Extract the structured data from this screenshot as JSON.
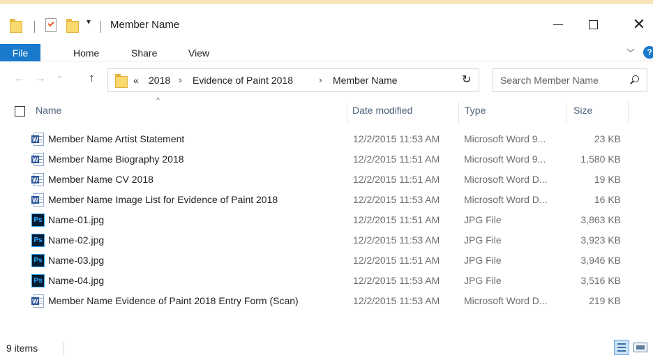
{
  "window": {
    "title": "Member Name",
    "qa_dropdown_glyph": "▾",
    "controls": {
      "minimize_icon": "minimize-icon",
      "maximize_icon": "maximize-icon",
      "close_icon": "close-icon"
    }
  },
  "ribbon": {
    "tabs": [
      {
        "label": "File"
      },
      {
        "label": "Home"
      },
      {
        "label": "Share"
      },
      {
        "label": "View"
      }
    ],
    "expand_glyph": "﹀",
    "help_glyph": "?",
    "accent_color": "#1979ca"
  },
  "nav": {
    "back_glyph": "←",
    "forward_glyph": "→",
    "recent_glyph": "⌄",
    "up_glyph": "↑",
    "refresh_glyph": "↻"
  },
  "address": {
    "overflow": "«",
    "crumbs": [
      "2018",
      "Evidence of Paint 2018",
      "Member Name"
    ],
    "separator": "›",
    "dropdown_glyph": "⌄"
  },
  "search": {
    "placeholder": "Search Member Name"
  },
  "columns": {
    "sort_glyph": "^",
    "name": "Name",
    "date": "Date modified",
    "type": "Type",
    "size": "Size"
  },
  "files": [
    {
      "icon": "word-doc-icon",
      "badge": "W",
      "name": "Member Name Artist Statement",
      "date": "12/2/2015 11:53 AM",
      "type": "Microsoft Word 9...",
      "size": "23 KB"
    },
    {
      "icon": "word-doc-icon",
      "badge": "W",
      "name": "Member Name Biography 2018",
      "date": "12/2/2015 11:51 AM",
      "type": "Microsoft Word 9...",
      "size": "1,580 KB"
    },
    {
      "icon": "word-docx-icon",
      "badge": "W",
      "name": "Member Name CV 2018",
      "date": "12/2/2015 11:51 AM",
      "type": "Microsoft Word D...",
      "size": "19 KB"
    },
    {
      "icon": "word-docx-icon",
      "badge": "W",
      "name": "Member Name Image List for Evidence of Paint 2018",
      "date": "12/2/2015 11:53 AM",
      "type": "Microsoft Word D...",
      "size": "16 KB"
    },
    {
      "icon": "photoshop-icon",
      "badge": "Ps",
      "name": "Name-01.jpg",
      "date": "12/2/2015 11:51 AM",
      "type": "JPG File",
      "size": "3,863 KB"
    },
    {
      "icon": "photoshop-icon",
      "badge": "Ps",
      "name": "Name-02.jpg",
      "date": "12/2/2015 11:53 AM",
      "type": "JPG File",
      "size": "3,923 KB"
    },
    {
      "icon": "photoshop-icon",
      "badge": "Ps",
      "name": "Name-03.jpg",
      "date": "12/2/2015 11:51 AM",
      "type": "JPG File",
      "size": "3,946 KB"
    },
    {
      "icon": "photoshop-icon",
      "badge": "Ps",
      "name": "Name-04.jpg",
      "date": "12/2/2015 11:53 AM",
      "type": "JPG File",
      "size": "3,516 KB"
    },
    {
      "icon": "word-docx-icon",
      "badge": "W",
      "name": "Member Name Evidence of Paint 2018 Entry Form (Scan)",
      "date": "12/2/2015 11:53 AM",
      "type": "Microsoft Word D...",
      "size": "219 KB"
    }
  ],
  "status": {
    "item_count": "9 items"
  }
}
